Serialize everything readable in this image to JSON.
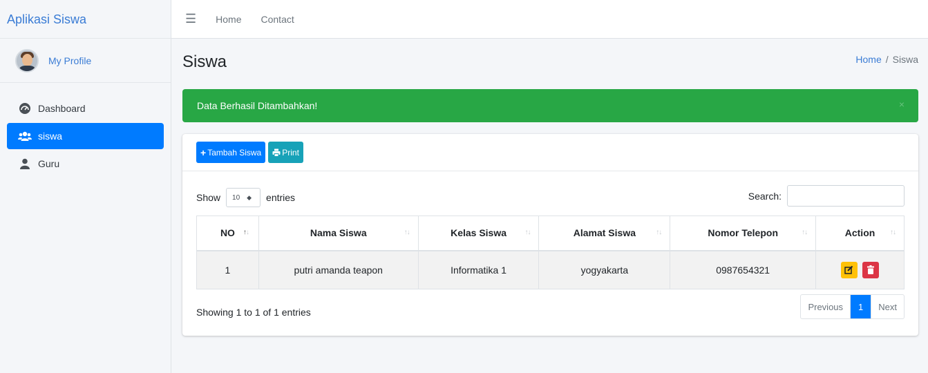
{
  "app": {
    "brand": "Aplikasi Siswa"
  },
  "user": {
    "profile_label": "My Profile"
  },
  "sidebar": {
    "items": [
      {
        "label": "Dashboard",
        "icon": "dashboard-icon"
      },
      {
        "label": "siswa",
        "icon": "users-icon",
        "active": true
      },
      {
        "label": "Guru",
        "icon": "user-icon"
      }
    ]
  },
  "topbar": {
    "home": "Home",
    "contact": "Contact",
    "menu_icon": "hamburger-icon"
  },
  "page": {
    "title": "Siswa"
  },
  "breadcrumb": {
    "home": "Home",
    "separator": "/",
    "current": "Siswa"
  },
  "alert": {
    "message": "Data Berhasil Ditambahkan!",
    "close": "×"
  },
  "toolbar": {
    "add_label": "Tambah Siswa",
    "print_label": "Print"
  },
  "table_controls": {
    "show_label": "Show",
    "entries_value": "10",
    "entries_label": "entries",
    "search_label": "Search:",
    "search_value": ""
  },
  "table": {
    "columns": [
      "NO",
      "Nama Siswa",
      "Kelas Siswa",
      "Alamat Siswa",
      "Nomor Telepon",
      "Action"
    ],
    "rows": [
      [
        "1",
        "putri amanda teapon",
        "Informatika 1",
        "yogyakarta",
        "0987654321"
      ]
    ]
  },
  "footer": {
    "info": "Showing 1 to 1 of 1 entries"
  },
  "pagination": {
    "previous": "Previous",
    "current": "1",
    "next": "Next"
  },
  "colors": {
    "primary": "#007bff",
    "success": "#28a745",
    "info": "#17a2b8",
    "warning": "#ffc107",
    "danger": "#dc3545",
    "brand": "#3a7cd5"
  }
}
